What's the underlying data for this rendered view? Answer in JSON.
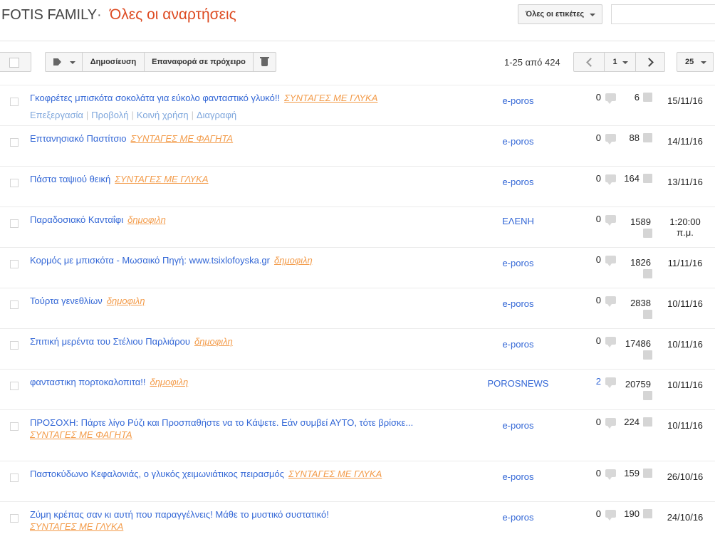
{
  "header": {
    "blog_title": "FOTIS FAMILY",
    "separator": "·",
    "section_title": "Όλες οι αναρτήσεις",
    "labels_filter": "Όλες οι ετικέτες"
  },
  "toolbar": {
    "publish_label": "Δημοσίευση",
    "revert_draft_label": "Επαναφορά σε πρόχειρο",
    "count_text": "1-25 από 424",
    "current_page": "1",
    "per_page": "25"
  },
  "row_actions": [
    "Επεξεργασία",
    "Προβολή",
    "Κοινή χρήση",
    "Διαγραφή"
  ],
  "posts": [
    {
      "title": "Γκοφρέτες μπισκότα σοκολάτα για εύκολο φανταστικό γλυκό!!",
      "label": "ΣΥΝΤΑΓΕΣ ΜΕ ΓΛΥΚΑ",
      "author": "e-poros",
      "comments": "0",
      "views": "6",
      "date": "15/11/16"
    },
    {
      "title": "Επτανησιακό Παστίτσιο",
      "label": "ΣΥΝΤΑΓΕΣ ΜΕ ΦΑΓΗΤΑ",
      "author": "e-poros",
      "comments": "0",
      "views": "88",
      "date": "14/11/16"
    },
    {
      "title": "Πάστα ταψιού θεική",
      "label": "ΣΥΝΤΑΓΕΣ ΜΕ ΓΛΥΚΑ",
      "author": "e-poros",
      "comments": "0",
      "views": "164",
      "date": "13/11/16"
    },
    {
      "title": "Παραδοσιακό Κανταΐφι",
      "label": "δημοφιλη",
      "author": "ΕΛΕΝΗ",
      "comments": "0",
      "views": "1589",
      "date": "1:20:00 π.μ."
    },
    {
      "title": "Κορμός με μπισκότα - Μωσαικό Πηγή: www.tsixlofoyska.gr",
      "label": "δημοφιλη",
      "author": "e-poros",
      "comments": "0",
      "views": "1826",
      "date": "11/11/16"
    },
    {
      "title": "Τούρτα γενεθλίων",
      "label": "δημοφιλη",
      "author": "e-poros",
      "comments": "0",
      "views": "2838",
      "date": "10/11/16"
    },
    {
      "title": "Σπιτική μερέντα του Στέλιου Παρλιάρου",
      "label": "δημοφιλη",
      "author": "e-poros",
      "comments": "0",
      "views": "17486",
      "date": "10/11/16"
    },
    {
      "title": "φανταστικη πορτοκαλοπιτα!!",
      "label": "δημοφιλη",
      "author": "POROSNEWS",
      "comments": "2",
      "views": "20759",
      "date": "10/11/16"
    },
    {
      "title": "ΠΡΟΣΟΧΗ: Πάρτε λίγο Ρύζι και Προσπαθήστε να το Κάψετε. Εάν συμβεί ΑΥΤΟ, τότε βρίσκε...",
      "label": "ΣΥΝΤΑΓΕΣ ΜΕ ΦΑΓΗΤΑ",
      "author": "e-poros",
      "comments": "0",
      "views": "224",
      "date": "10/11/16"
    },
    {
      "title": "Παστοκύδωνο Κεφαλονιάς, ο γλυκός χειμωνιάτικος πειρασμός",
      "label": "ΣΥΝΤΑΓΕΣ ΜΕ ΓΛΥΚΑ",
      "author": "e-poros",
      "comments": "0",
      "views": "159",
      "date": "26/10/16"
    },
    {
      "title": "Ζύμη κρέπας σαν κι αυτή που παραγγέλνεις! Μάθε το μυστικό συστατικό!",
      "label": "ΣΥΝΤΑΓΕΣ ΜΕ ΓΛΥΚΑ",
      "author": "e-poros",
      "comments": "0",
      "views": "190",
      "date": "24/10/16"
    }
  ]
}
